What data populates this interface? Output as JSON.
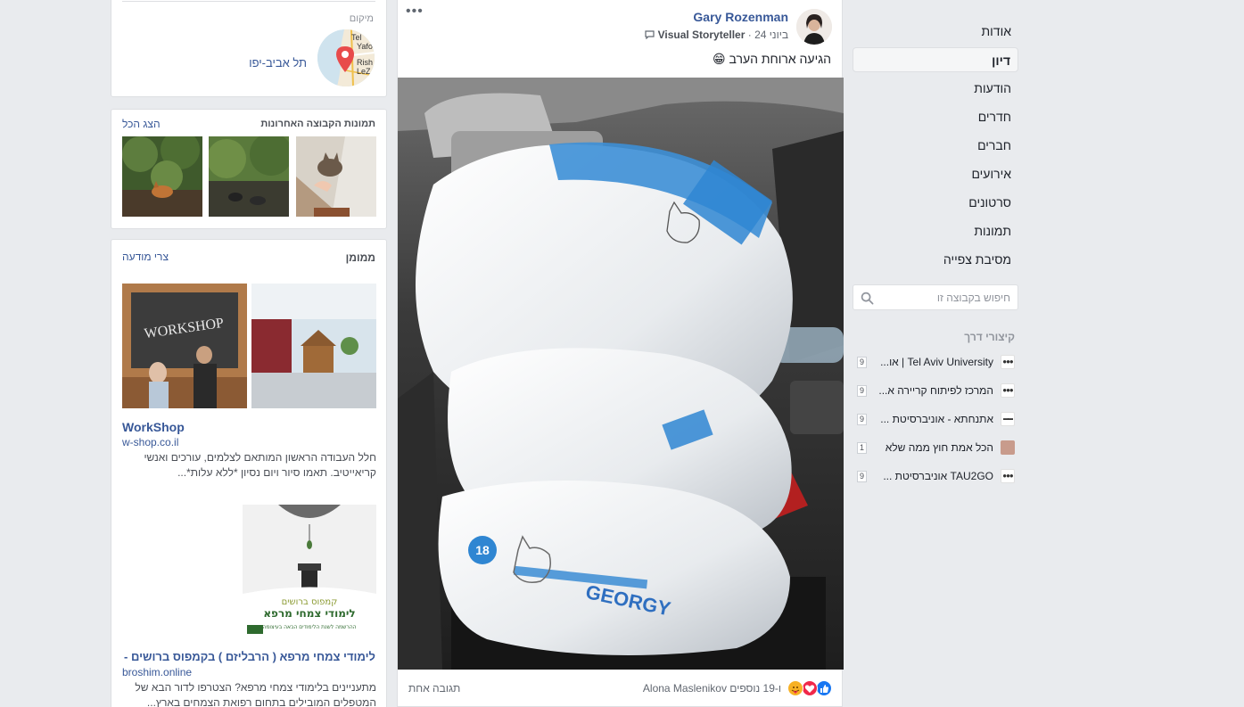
{
  "right_nav": {
    "items": [
      {
        "label": "אודות",
        "active": false
      },
      {
        "label": "דיון",
        "active": true
      },
      {
        "label": "הודעות",
        "active": false
      },
      {
        "label": "חדרים",
        "active": false
      },
      {
        "label": "חברים",
        "active": false
      },
      {
        "label": "אירועים",
        "active": false
      },
      {
        "label": "סרטונים",
        "active": false
      },
      {
        "label": "תמונות",
        "active": false
      },
      {
        "label": "מסיבת צפייה",
        "active": false
      }
    ],
    "search_placeholder": "חיפוש בקבוצה זו"
  },
  "shortcuts": {
    "title": "קיצורי דרך",
    "items": [
      {
        "label": "Tel Aviv University | או...",
        "count": "9",
        "icon": "tau-logo"
      },
      {
        "label": "המרכז לפיתוח קריירה א...",
        "count": "9",
        "icon": "tau-logo"
      },
      {
        "label": "אתנחתא - אוניברסיטת ...",
        "count": "9",
        "icon": "group-logo"
      },
      {
        "label": "הכל אמת חוץ ממה שלא",
        "count": "1",
        "icon": "profile-photo"
      },
      {
        "label": "TAU2GO אוניברסיטת ...",
        "count": "9",
        "icon": "tau-logo"
      }
    ]
  },
  "post": {
    "author": "Gary Rozenman",
    "meta_badge": "Visual Storyteller",
    "meta_suffix": "ביוני",
    "meta_time": "24",
    "text": "הגיעה ארוחת הערב 😁",
    "photo_brand": "GEORGY",
    "photo_weight": "18",
    "reactions_text": "Alona Maslenikov ו-19 נוספים",
    "comments_text": "תגובה אחת",
    "more_icon": "•••"
  },
  "location_card": {
    "title": "מיקום",
    "place": "תל אביב-יפו",
    "map_labels": [
      "Tel",
      "Yafo",
      "Rish",
      "LeZ"
    ]
  },
  "photos_card": {
    "title": "תמונות הקבוצה האחרונות",
    "see_all": "הצג הכל"
  },
  "sponsored_card": {
    "title": "ממומן",
    "create_ad": "צרי מודעה",
    "ads": [
      {
        "title": "WorkShop",
        "domain": "w-shop.co.il",
        "description": "חלל העבודה הראשון המותאם לצלמים, עורכים ואנשי קריאייטיב. תאמו סיור ויום נסיון *ללא עלות*...",
        "image_text": "WORKSHOP"
      },
      {
        "title": "לימודי צמחי מרפא ( הרבליזם ) בקמפוס ברושים - ...",
        "domain": "broshim.online",
        "description": "מתעניינים בלימודי צמחי מרפא? הצטרפו לדור הבא של המטפלים המובילים בתחום רפואת הצמחים בארץ...",
        "image_line1": "קמפוס ברושים",
        "image_line2": "לימודי צמחי מרפא",
        "image_line3": "ההרשמה לשנת הלימודים הבאה בעיצומה"
      }
    ]
  },
  "colors": {
    "background": "#e9ebee",
    "link": "#385898",
    "like": "#1877f2",
    "love": "#f0284a"
  }
}
